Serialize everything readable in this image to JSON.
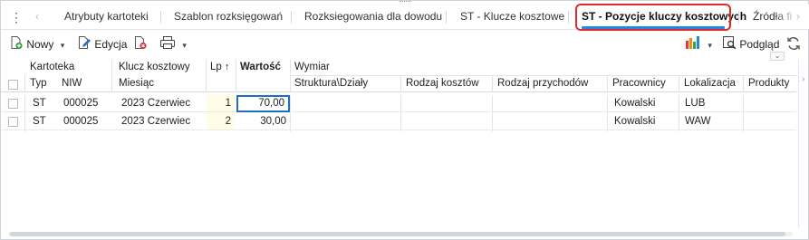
{
  "tabs": [
    {
      "label": "Atrybuty kartoteki"
    },
    {
      "label": "Szablon rozksięgowań"
    },
    {
      "label": "Rozksiegowania dla dowodu"
    },
    {
      "label": "ST - Klucze kosztowe"
    },
    {
      "label": "ST - Pozycje kluczy kosztowych"
    },
    {
      "label": "Źródła fi"
    }
  ],
  "toolbar": {
    "new_label": "Nowy",
    "edit_label": "Edycja",
    "preview_label": "Podgląd"
  },
  "grid": {
    "header_top": {
      "kartoteka": "Kartoteka",
      "klucz": "Klucz kosztowy",
      "lp": "Lp",
      "wartosc": "Wartość",
      "wymiar": "Wymiar"
    },
    "header_bottom": {
      "typ": "Typ",
      "niw": "NIW",
      "miesiac": "Miesiąc",
      "struktura": "Struktura\\Działy",
      "rodzaj_kosztow": "Rodzaj kosztów",
      "rodzaj_przychodow": "Rodzaj przychodów",
      "pracownicy": "Pracownicy",
      "lokalizacja": "Lokalizacja",
      "produkty": "Produkty"
    },
    "rows": [
      {
        "typ": "ST",
        "niw": "000025",
        "miesiac": "2023 Czerwiec",
        "lp": "1",
        "wartosc": "70,00",
        "pracownicy": "Kowalski",
        "lokalizacja": "LUB"
      },
      {
        "typ": "ST",
        "niw": "000025",
        "miesiac": "2023 Czerwiec",
        "lp": "2",
        "wartosc": "30,00",
        "pracownicy": "Kowalski",
        "lokalizacja": "WAW"
      }
    ]
  },
  "colors": {
    "accent": "#1e88e5",
    "highlight": "#e02b2b",
    "lp_bg": "#fffde7"
  }
}
